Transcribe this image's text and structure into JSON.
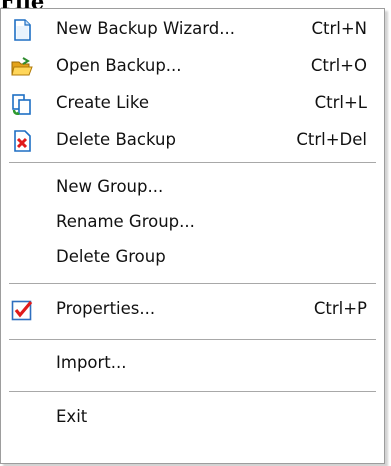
{
  "menubar": {
    "title": "File"
  },
  "menu": {
    "items": [
      {
        "label": "New Backup Wizard...",
        "shortcut": "Ctrl+N",
        "icon": "document-icon"
      },
      {
        "label": "Open Backup...",
        "shortcut": "Ctrl+O",
        "icon": "open-folder-icon"
      },
      {
        "label": "Create Like",
        "shortcut": "Ctrl+L",
        "icon": "copy-icon"
      },
      {
        "label": "Delete Backup",
        "shortcut": "Ctrl+Del",
        "icon": "delete-icon"
      },
      {
        "label": "New Group..."
      },
      {
        "label": "Rename Group..."
      },
      {
        "label": "Delete Group"
      },
      {
        "label": "Properties...",
        "shortcut": "Ctrl+P",
        "icon": "checkmark-icon"
      },
      {
        "label": "Import..."
      },
      {
        "label": "Exit"
      }
    ]
  }
}
